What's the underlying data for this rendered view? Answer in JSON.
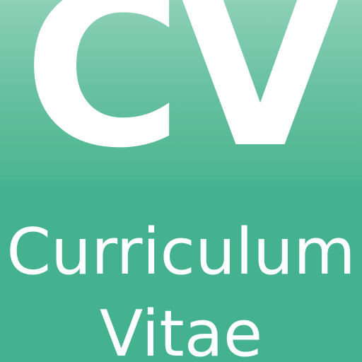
{
  "icon": {
    "abbreviation": "CV",
    "title_line_1": "Curriculum",
    "title_line_2": "Vitae"
  },
  "colors": {
    "background": "#44b28e",
    "gloss_top": "#8dd0b8",
    "text": "#ffffff"
  }
}
